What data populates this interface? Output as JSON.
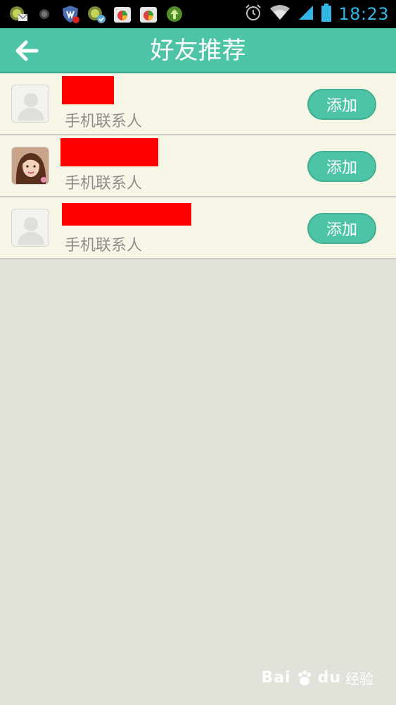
{
  "status_bar": {
    "time": "18:23",
    "left_icons": [
      "mail-notification-icon",
      "record-icon",
      "shield-alert-icon",
      "sync-check-icon",
      "app-store-icon",
      "app-store-icon",
      "upload-icon"
    ],
    "right_icons": [
      "alarm-clock-icon",
      "wifi-icon",
      "signal-icon",
      "battery-icon"
    ]
  },
  "header": {
    "title": "好友推荐",
    "back_icon": "back-arrow-icon"
  },
  "contacts": [
    {
      "subtitle": "手机联系人",
      "add_label": "添加",
      "avatar": "default-avatar"
    },
    {
      "subtitle": "手机联系人",
      "add_label": "添加",
      "avatar": "photo-avatar"
    },
    {
      "subtitle": "手机联系人",
      "add_label": "添加",
      "avatar": "default-avatar"
    }
  ],
  "watermark": {
    "brand": "Bai",
    "brand_suffix": "du",
    "sub": "经验"
  },
  "colors": {
    "accent": "#4dc4a6",
    "list_bg": "#f7f5e6",
    "page_bg": "#e2e1da",
    "redaction": "#ff0000",
    "time_text": "#33b5e5"
  }
}
